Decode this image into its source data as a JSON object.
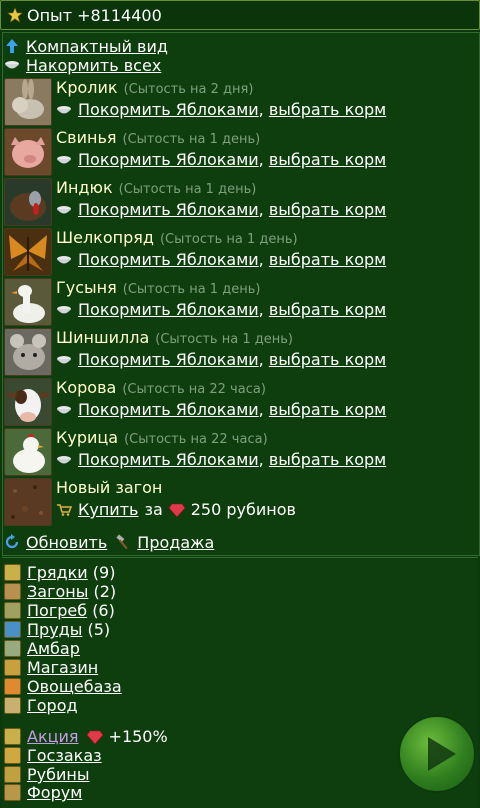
{
  "header": {
    "xp_text": "Опыт +8114400"
  },
  "top_links": {
    "compact": "Компактный вид",
    "feed_all": "Накормить всех"
  },
  "animals": [
    {
      "name": "Кролик",
      "satiety": "(Сытость на 2 дня)",
      "feed": "Покормить Яблоками",
      "choose": "выбрать корм"
    },
    {
      "name": "Свинья",
      "satiety": "(Сытость на 1 день)",
      "feed": "Покормить Яблоками",
      "choose": "выбрать корм"
    },
    {
      "name": "Индюк",
      "satiety": "(Сытость на 1 день)",
      "feed": "Покормить Яблоками",
      "choose": "выбрать корм"
    },
    {
      "name": "Шелкопряд",
      "satiety": "(Сытость на 1 день)",
      "feed": "Покормить Яблоками",
      "choose": "выбрать корм"
    },
    {
      "name": "Гусыня",
      "satiety": "(Сытость на 1 день)",
      "feed": "Покормить Яблоками",
      "choose": "выбрать корм"
    },
    {
      "name": "Шиншилла",
      "satiety": "(Сытость на 1 день)",
      "feed": "Покормить Яблоками",
      "choose": "выбрать корм"
    },
    {
      "name": "Корова",
      "satiety": "(Сытость на 22 часа)",
      "feed": "Покормить Яблоками",
      "choose": "выбрать корм"
    },
    {
      "name": "Курица",
      "satiety": "(Сытость на 22 часа)",
      "feed": "Покормить Яблоками",
      "choose": "выбрать корм"
    }
  ],
  "new_pen": {
    "title": "Новый загон",
    "buy": "Купить",
    "for": "за",
    "price": "250 рубинов"
  },
  "bottom_actions": {
    "refresh": "Обновить",
    "sell": "Продажа"
  },
  "menu": [
    {
      "label": "Грядки",
      "count": "(9)"
    },
    {
      "label": "Загоны",
      "count": "(2)"
    },
    {
      "label": "Погреб",
      "count": "(6)"
    },
    {
      "label": "Пруды",
      "count": "(5)"
    },
    {
      "label": "Амбар",
      "count": ""
    },
    {
      "label": "Магазин",
      "count": ""
    },
    {
      "label": "Овощебаза",
      "count": ""
    },
    {
      "label": "Город",
      "count": ""
    }
  ],
  "menu2": {
    "promo": "Акция",
    "promo_bonus": "+150%",
    "gov_order": "Госзаказ",
    "rubies": "Рубины",
    "forum": "Форум"
  },
  "colors": {
    "background": "#0d3a0d",
    "link": "#ffffff",
    "promo": "#c59be6",
    "satiety": "#7f9f7f"
  }
}
